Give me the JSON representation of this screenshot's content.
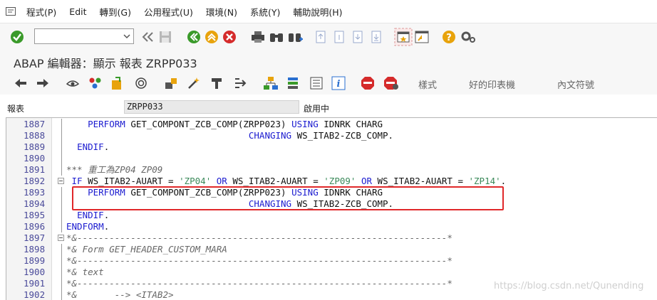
{
  "menu": {
    "items": [
      "程式(P)",
      "Edit",
      "轉到(G)",
      "公用程式(U)",
      "環境(N)",
      "系統(Y)",
      "輔助說明(H)"
    ]
  },
  "toolbar": {
    "command_field_value": "",
    "icons": [
      "enter-check-icon",
      "back-double-arrow-icon",
      "save-icon",
      "back-icon",
      "exit-icon",
      "cancel-icon",
      "print-icon",
      "find-icon",
      "find-next-icon",
      "first-page-icon",
      "previous-page-icon",
      "next-page-icon",
      "last-page-icon",
      "create-session-icon",
      "generate-shortcut-icon",
      "help-icon",
      "customize-layout-icon"
    ]
  },
  "title": "ABAP 編輯器：顯示 報表 ZRPP033",
  "app_toolbar": {
    "text_buttons": [
      "樣式",
      "好的印表機",
      "內文符號"
    ]
  },
  "info": {
    "label": "報表",
    "program": "ZRPP033",
    "status": "啟用中"
  },
  "editor": {
    "lines": [
      {
        "num": "1887",
        "parts": [
          [
            "plain",
            "    "
          ],
          [
            "kw",
            "PERFORM"
          ],
          [
            "plain",
            " GET_COMPONT_ZCB_COMP(ZRPP023) "
          ],
          [
            "kw",
            "USING"
          ],
          [
            "plain",
            " IDNRK CHARG"
          ]
        ]
      },
      {
        "num": "1888",
        "parts": [
          [
            "plain",
            "                                  "
          ],
          [
            "kw",
            "CHANGING"
          ],
          [
            "plain",
            " WS_ITAB2-ZCB_COMP."
          ]
        ]
      },
      {
        "num": "1889",
        "parts": [
          [
            "plain",
            "  "
          ],
          [
            "kw",
            "ENDIF"
          ],
          [
            "plain",
            "."
          ]
        ]
      },
      {
        "num": "1890",
        "parts": []
      },
      {
        "num": "1891",
        "parts": [
          [
            "cm",
            "*** 重工為ZP04 ZP09"
          ]
        ]
      },
      {
        "num": "1892",
        "fold": true,
        "parts": [
          [
            "plain",
            " "
          ],
          [
            "kw",
            "IF"
          ],
          [
            "plain",
            " WS_ITAB2-AUART = "
          ],
          [
            "str",
            "'ZP04'"
          ],
          [
            "plain",
            " "
          ],
          [
            "kw",
            "OR"
          ],
          [
            "plain",
            " WS_ITAB2-AUART = "
          ],
          [
            "str",
            "'ZP09'"
          ],
          [
            "plain",
            " "
          ],
          [
            "kw",
            "OR"
          ],
          [
            "plain",
            " WS_ITAB2-AUART = "
          ],
          [
            "str",
            "'ZP14'"
          ],
          [
            "plain",
            "."
          ]
        ]
      },
      {
        "num": "1893",
        "parts": [
          [
            "plain",
            "    "
          ],
          [
            "kw",
            "PERFORM"
          ],
          [
            "plain",
            " GET_COMPONT_ZCB_COMP(ZRPP023) "
          ],
          [
            "kw",
            "USING"
          ],
          [
            "plain",
            " IDNRK CHARG"
          ]
        ]
      },
      {
        "num": "1894",
        "parts": [
          [
            "plain",
            "                                  "
          ],
          [
            "kw",
            "CHANGING"
          ],
          [
            "plain",
            " WS_ITAB2-ZCB_COMP."
          ]
        ]
      },
      {
        "num": "1895",
        "parts": [
          [
            "plain",
            "  "
          ],
          [
            "kw",
            "ENDIF"
          ],
          [
            "plain",
            "."
          ]
        ]
      },
      {
        "num": "1896",
        "parts": [
          [
            "kw",
            "ENDFORM"
          ],
          [
            "plain",
            "."
          ]
        ]
      },
      {
        "num": "1897",
        "fold": true,
        "parts": [
          [
            "cm",
            "*&---------------------------------------------------------------------*"
          ]
        ]
      },
      {
        "num": "1898",
        "parts": [
          [
            "cm",
            "*& Form GET_HEADER_CUSTOM_MARA"
          ]
        ]
      },
      {
        "num": "1899",
        "parts": [
          [
            "cm",
            "*&---------------------------------------------------------------------*"
          ]
        ]
      },
      {
        "num": "1900",
        "parts": [
          [
            "cm",
            "*& text"
          ]
        ]
      },
      {
        "num": "1901",
        "parts": [
          [
            "cm",
            "*&---------------------------------------------------------------------*"
          ]
        ]
      },
      {
        "num": "1902",
        "parts": [
          [
            "cm",
            "*&       --> <ITAB2>"
          ]
        ]
      }
    ]
  },
  "watermark": "https://blog.csdn.net/Qunending",
  "colors": {
    "keyword": "#1c1cd0",
    "string": "#3b8a5a",
    "comment": "#666666",
    "highlight_box": "#e0282a"
  }
}
